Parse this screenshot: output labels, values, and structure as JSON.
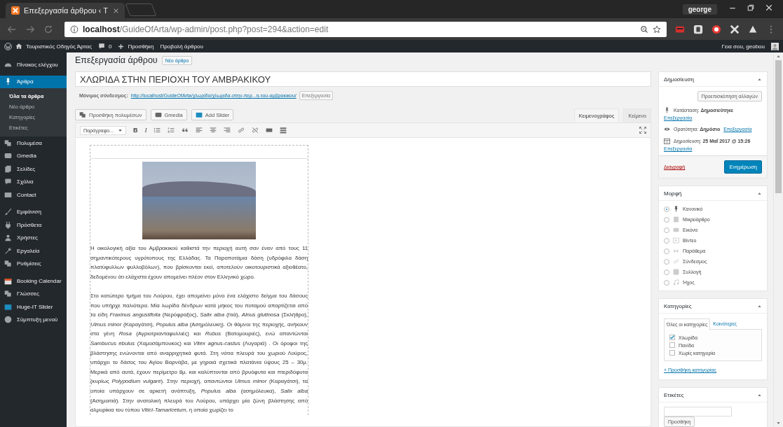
{
  "browser": {
    "tab_title": "Επεξεργασία άρθρου ‹ T",
    "user": "george",
    "url_host": "localhost",
    "url_path": "/GuideOfArta/wp-admin/post.php?post=294&action=edit"
  },
  "admin_bar": {
    "site": "Τουριστικός Οδηγός Άρτας",
    "comments": "0",
    "new": "Προσθήκη",
    "view": "Προβολή άρθρου",
    "greeting": "Γεια σου, geobou"
  },
  "sidebar": {
    "groups": [
      {
        "items": [
          {
            "label": "Πίνακας ελέγχου",
            "selected": false
          }
        ]
      },
      {
        "items": [
          {
            "label": "Άρθρα",
            "selected": true,
            "children": [
              {
                "label": "Όλα τα άρθρα",
                "selected": true
              },
              {
                "label": "Νέο άρθρο",
                "selected": false
              },
              {
                "label": "Κατηγορίες",
                "selected": false
              },
              {
                "label": "Ετικέτες",
                "selected": false
              }
            ]
          },
          {
            "label": "Πολυμέσα",
            "selected": false
          },
          {
            "label": "Gmedia",
            "selected": false
          },
          {
            "label": "Σελίδες",
            "selected": false
          },
          {
            "label": "Σχόλια",
            "selected": false
          },
          {
            "label": "Contact",
            "selected": false
          }
        ]
      },
      {
        "items": [
          {
            "label": "Εμφάνιση",
            "selected": false
          },
          {
            "label": "Πρόσθετα",
            "selected": false
          },
          {
            "label": "Χρήστες",
            "selected": false
          },
          {
            "label": "Εργαλεία",
            "selected": false
          },
          {
            "label": "Ρυθμίσεις",
            "selected": false
          }
        ]
      },
      {
        "items": [
          {
            "label": "Booking Calendar",
            "selected": false
          },
          {
            "label": "Γλώσσες",
            "selected": false
          },
          {
            "label": "Huge-IT Slider",
            "selected": false
          },
          {
            "label": "Σύμπτυξη μενού",
            "selected": false
          }
        ]
      }
    ]
  },
  "editor": {
    "heading": "Επεξεργασία άρθρου",
    "new_button": "Νέο άρθρο",
    "title": "ΧΛΩΡΙΔΑ ΣΤΗΝ ΠΕΡΙΟΧΗ ΤΟΥ ΑΜΒΡΑΚΙΚΟΥ",
    "permalink_label": "Μόνιμος σύνδεσμος:",
    "permalink": "http://localhost/GuideOfArta/χλωρίδα/χλωριδα-στην-περ...η-του-αμβρακικου/",
    "permalink_edit": "Επεξεργασία",
    "media_buttons": [
      "Προσθήκη πολυμέσων",
      "Gmedia",
      "Add Slider"
    ],
    "modes": [
      {
        "label": "Κειμενογράφος",
        "selected": true
      },
      {
        "label": "Κείμενο",
        "selected": false
      }
    ],
    "format_select": "Παράγραφο...",
    "toolbar_letters": [
      "B",
      "I"
    ],
    "paragraphs": [
      "Η οικολογική αξία του Αμβρακικού καθιστά την περιοχή αυτή σαν έναν από τους 11 σημαντικότερους υγρότοπους της Ελλάδας. Τα Παραποτάμια δάση (υδρόφιλα δάση πλατύφυλλων φυλλοβόλων), που βρίσκονται εκεί, αποτελούν οικοτουριστικά αξιοθέατο, δεδομένου ότι ελάχιστα έχουν απομείνει πλέον στον Ελληνικό χώρο.",
      "Στο κατώτερο τμήμα του Λούρου, έχει απομείνει μόνο ένα ελάχιστο δείγμα του δάσους που υπήρχε παλιότερα. Μία λωρίδα δένδρων κατά μήκος του ποταμού απαρτίζεται από τα είδη *Fraxinus angustifolia* (Νερόφραξος), *Salix alba* (Ιτιά), *Alnus glutinosa* (Σκλήθρο), *Ulmus minor* (Καραγάτσι), *Populus alba* (Ασημόλευκη). Οι θάμνοι της περιοχής, ανήκουν στα γένη *Rosa* (Αγριοτριανταφυλλιές) και *Rubus* (Βατομουριές), ενώ απαντώνται *Sambucus ebulus* (Χαμοσάμπουκος) και *Vitex agnus-castus* (Λυγαριά) . Οι όροφοι της βλάστησης ενώνονται από αναρριχητικά φυτά. Στη νότια πλευρά του χωριού Λούρος, υπάρχει το δάσος του Αγίου Βαρνάβα, με γηραιά σχετικά πλατάνια ύψους 25 – 30μ. Μερικά από αυτά, έχουν περίμετρο 8μ. και καλύπτονται από βρυόφυτα και πτεριδόφυτα (κυρίως *Polypodium vulgare*). Στην περιοχή, απαντώνται *Ulmus minor* (Καραγάτσι), τα οποία υπάρχουν σε αρκετή ανάπτυξη, *Populus alba* (ασημόλευκα), *Salix alba* (Ασημοιτιά). Στην ανατολική πλευρά του Λούρου, υπάρχει μία ζώνη βλάστησης από αλμυρίκια του τύπου *Vitici-Tamaricetum*, η οποία χωρίζει το"
    ]
  },
  "publish": {
    "title": "Δημοσίευση",
    "preview": "Προεπισκόπηση αλλαγών",
    "status": "Κατάσταση: **Δημοσιεύτηκε**",
    "status_edit": "Επεξεργασία",
    "visibility": "Ορατότητα: **Δημόσιο**",
    "visibility_edit": "Επεξεργασία",
    "date": "Δημοσίευση: **25 Μαΐ 2017 @ 15:26**",
    "date_edit": "Επεξεργασία",
    "trash": "Διαγραφή",
    "update": "Ενημέρωση"
  },
  "format": {
    "title": "Μορφή",
    "options": [
      {
        "label": "Κανονικό",
        "selected": true
      },
      {
        "label": "Μικροάρθρο",
        "selected": false
      },
      {
        "label": "Εικόνα",
        "selected": false
      },
      {
        "label": "Βίντεο",
        "selected": false
      },
      {
        "label": "Παράθεμα",
        "selected": false
      },
      {
        "label": "Σύνδεσμος",
        "selected": false
      },
      {
        "label": "Συλλογή",
        "selected": false
      },
      {
        "label": "Ήχος",
        "selected": false
      }
    ]
  },
  "categories": {
    "title": "Κατηγορίες",
    "tabs": [
      {
        "label": "Όλες οι κατηγορίες",
        "selected": true
      },
      {
        "label": "Κοινότερες",
        "selected": false
      }
    ],
    "items": [
      {
        "label": "Χλωρίδα",
        "checked": true
      },
      {
        "label": "Πανίδα",
        "checked": false
      },
      {
        "label": "Χωρίς κατηγορία",
        "checked": false
      }
    ],
    "add": "+ Προσθήκη κατηγορίας"
  },
  "tags": {
    "title": "Ετικέτες",
    "add_button": "Προσθήκη"
  }
}
